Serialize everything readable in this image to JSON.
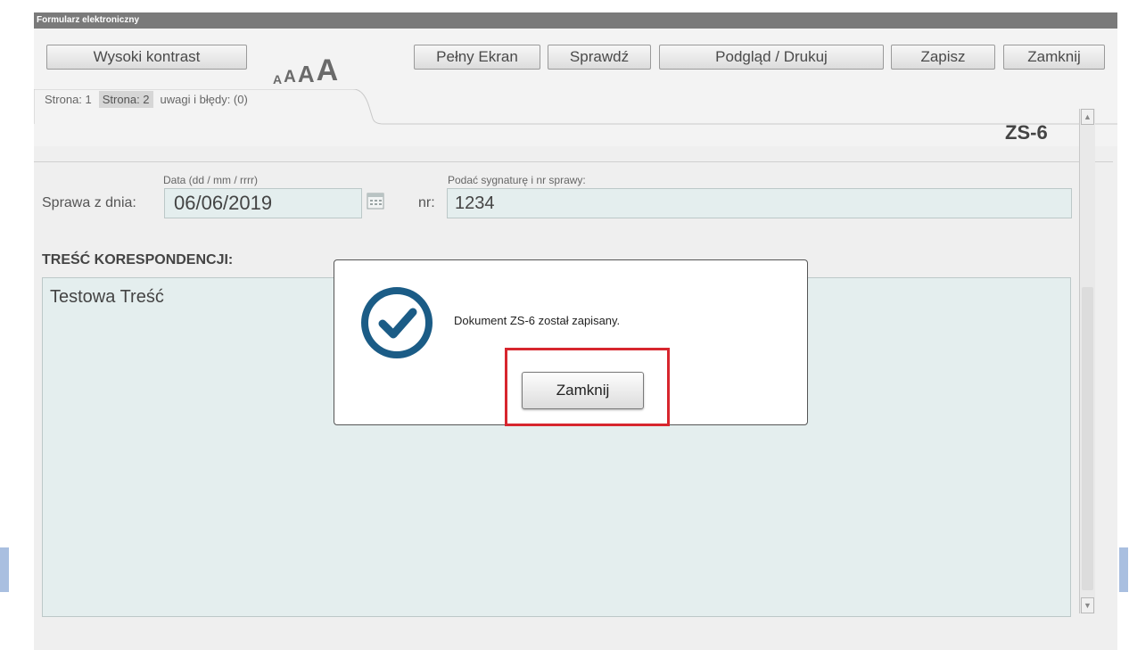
{
  "window": {
    "title": "Formularz elektroniczny"
  },
  "toolbar": {
    "high_contrast": "Wysoki kontrast",
    "font_sizes": [
      "A",
      "A",
      "A",
      "A"
    ],
    "fullscreen": "Pełny Ekran",
    "check": "Sprawdź",
    "preview_print": "Podgląd / Drukuj",
    "save": "Zapisz",
    "close": "Zamknij"
  },
  "tabs": [
    {
      "label": "Strona: 1",
      "active": false
    },
    {
      "label": "Strona: 2",
      "active": true
    },
    {
      "label": "uwagi i błędy: (0)",
      "active": false
    }
  ],
  "form": {
    "doc_id": "ZS-6",
    "date_hint": "Data (dd / mm / rrrr)",
    "case_label": "Sprawa z dnia:",
    "date_value": "06/06/2019",
    "signature_hint": "Podać sygnaturę i nr sprawy:",
    "nr_label": "nr:",
    "nr_value": "1234",
    "content_title": "TREŚĆ KORESPONDENCJI:",
    "content_value": "Testowa Treść"
  },
  "dialog": {
    "message": "Dokument ZS-6 został zapisany.",
    "button": "Zamknij",
    "icon": "checkmark-circle-icon"
  },
  "colors": {
    "titlebar": "#7a7a7a",
    "field_bg": "#e4eeee",
    "check_icon": "#1b5c86",
    "highlight": "#d7262e"
  }
}
